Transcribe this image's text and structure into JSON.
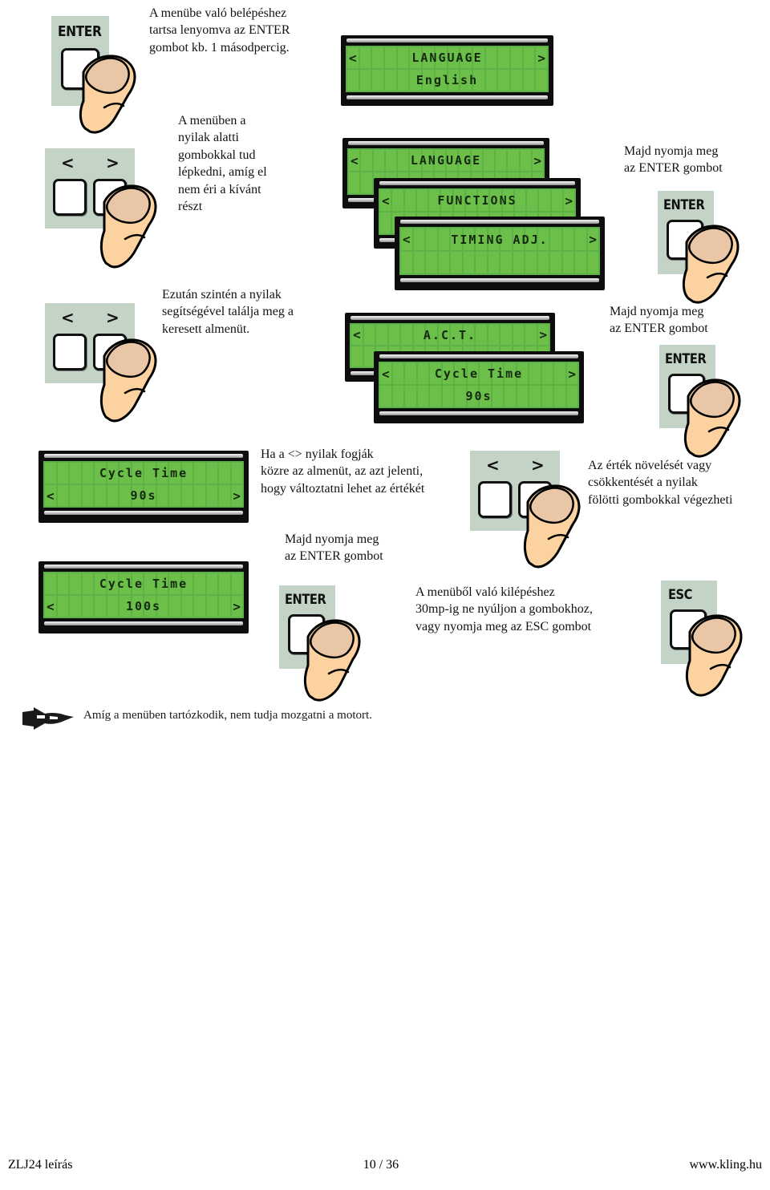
{
  "page": {
    "language": "hu",
    "footnote": "Amíg a menüben tartózkodik, nem tudja mozgatni a motort.",
    "footnote_icon": "pointing-hand-icon"
  },
  "colors": {
    "lcd_screen": "#5cb246",
    "lcd_cell": "#6cc04a",
    "lcd_text": "#15290f",
    "lcd_bezel": "#0d0d0d",
    "keypad_panel": "#c3d4c7",
    "key_face": "#ffffff",
    "finger_skin": "#fcd3a0",
    "finger_nail": "#e8c3a4"
  },
  "steps": [
    {
      "id": "enter-menu",
      "text": "A menübe való belépéshez\ntartsa lenyomva az ENTER\ngombot kb. 1 másodpercig.",
      "key": "ENTER"
    },
    {
      "id": "navigate-arrows",
      "text": "A menüben a\nnyilak alatti\ngombokkal tud\nlépkedni, amíg el\nnem éri a kívánt\nrészt",
      "key_left": "<",
      "key_right": ">"
    },
    {
      "id": "confirm-enter-1",
      "text": "Majd nyomja meg\naz ENTER gombot",
      "key": "ENTER"
    },
    {
      "id": "find-submenu",
      "text": "Ezután szintén a nyilak\nsegítségével találja meg a\nkeresett almenüt.",
      "key_left": "<",
      "key_right": ">"
    },
    {
      "id": "confirm-enter-2",
      "text": "Majd nyomja meg\naz ENTER gombot",
      "key": "ENTER"
    },
    {
      "id": "editable-hint",
      "text": "Ha a <> nyilak fogják\nközre az almenüt, az azt jelenti,\nhogy változtatni lehet az értékét"
    },
    {
      "id": "increase-decrease",
      "text": "Az érték növelését vagy\ncsökkentését a nyilak\nfölötti gombokkal végezheti",
      "key_left": "<",
      "key_right": ">"
    },
    {
      "id": "confirm-enter-3",
      "text": "Majd nyomja meg\naz ENTER gombot",
      "key": "ENTER"
    },
    {
      "id": "exit-menu",
      "text": "A menüből való kilépéshez\n30mp-ig ne nyúljon a gombokhoz,\nvagy nyomja meg az ESC gombot",
      "key": "ESC"
    }
  ],
  "keys": {
    "enter_label": "ENTER",
    "esc_label": "ESC",
    "arrow_left": "<",
    "arrow_right": ">"
  },
  "displays": [
    {
      "id": "lcd-language-english",
      "line1": "LANGUAGE",
      "line2": "English",
      "arrow_left_row": 1,
      "arrow_right_row": 1,
      "cells": 16
    },
    {
      "id": "lcd-language",
      "line1": "LANGUAGE",
      "line2": "",
      "arrow_left_row": 1,
      "arrow_right_row": 1,
      "cells": 16
    },
    {
      "id": "lcd-functions",
      "line1": "FUNCTIONS",
      "line2": "",
      "arrow_left_row": 1,
      "arrow_right_row": 1,
      "cells": 16
    },
    {
      "id": "lcd-timing-adj",
      "line1": "TIMING ADJ.",
      "line2": "",
      "arrow_left_row": 1,
      "arrow_right_row": 1,
      "cells": 16
    },
    {
      "id": "lcd-act",
      "line1": "A.C.T.",
      "line2": "",
      "arrow_left_row": 1,
      "arrow_right_row": 1,
      "cells": 16
    },
    {
      "id": "lcd-cycle-time-90s-top",
      "line1": "Cycle Time",
      "line2": "90s",
      "arrow_left_row": 1,
      "arrow_right_row": 1,
      "cells": 16
    },
    {
      "id": "lcd-cycle-time-90s-value",
      "line1": "Cycle Time",
      "line2": "90s",
      "arrow_left_row": 2,
      "arrow_right_row": 2,
      "cells": 16
    },
    {
      "id": "lcd-cycle-time-100s-value",
      "line1": "Cycle Time",
      "line2": "100s",
      "arrow_left_row": 2,
      "arrow_right_row": 2,
      "cells": 16
    }
  ],
  "footer": {
    "left": "ZLJ24 leírás",
    "center": "10 / 36",
    "right": "www.kling.hu"
  }
}
